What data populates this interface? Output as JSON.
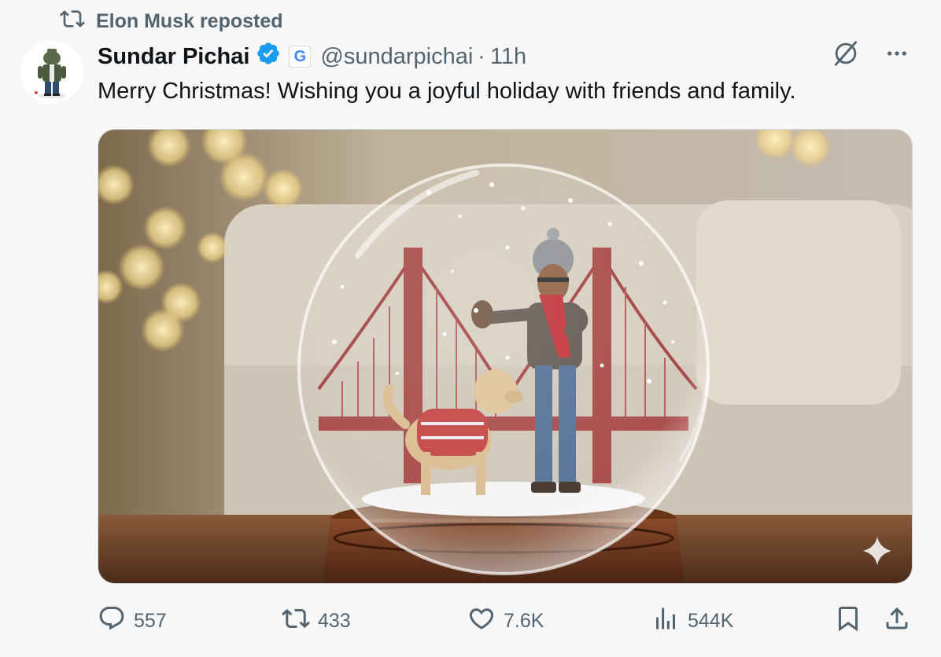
{
  "repost": {
    "text": "Elon Musk reposted",
    "icon": "repost-icon"
  },
  "tweet": {
    "author_name": "Sundar Pichai",
    "handle": "@sundarpichai",
    "separator": "·",
    "time": "11h",
    "affiliation_badge": "G",
    "text": "Merry Christmas! Wishing you a joyful holiday with friends and family."
  },
  "actions": {
    "replies": "557",
    "reposts": "433",
    "likes": "7.6K",
    "views": "544K"
  },
  "colors": {
    "verified": "#1d9bf0",
    "secondary_text": "#536471",
    "background": "#f7f7f8"
  },
  "icons": [
    "repost-icon",
    "verified-icon",
    "grok-icon",
    "more-icon",
    "reply-icon",
    "like-icon",
    "views-icon",
    "bookmark-icon",
    "share-icon",
    "sparkle-icon"
  ]
}
